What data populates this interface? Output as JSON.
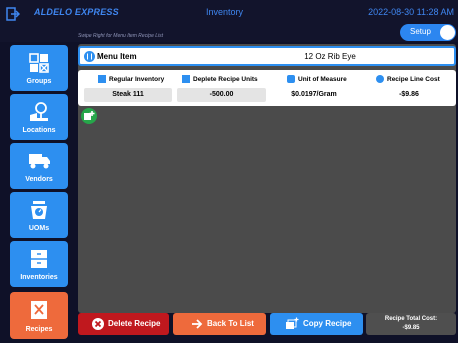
{
  "header": {
    "app_title": "ALDELO EXPRESS",
    "page_title": "Inventory",
    "datetime": "2022-08-30 11:28 AM",
    "setup_label": "Setup",
    "hint": "Swipe Right for Menu Item Recipe List"
  },
  "sidebar": {
    "items": [
      {
        "label": "Groups",
        "icon": "groups-grid-icon"
      },
      {
        "label": "Locations",
        "icon": "location-pin-icon"
      },
      {
        "label": "Vendors",
        "icon": "truck-icon"
      },
      {
        "label": "UOMs",
        "icon": "scale-icon"
      },
      {
        "label": "Inventories",
        "icon": "cabinet-icon"
      },
      {
        "label": "Recipes",
        "icon": "recipe-icon"
      }
    ],
    "active": "Recipes"
  },
  "menu_item": {
    "label": "Menu Item",
    "value": "12 Oz Rib Eye"
  },
  "recipe_table": {
    "columns": [
      "Regular Inventory",
      "Deplete Recipe Units",
      "Unit of Measure",
      "Recipe Line Cost"
    ],
    "row": {
      "regular_inventory": "Steak 111",
      "deplete_recipe_units": "-500.00",
      "unit_of_measure": "$0.0197/Gram",
      "recipe_line_cost": "-$9.86"
    }
  },
  "footer": {
    "delete_label": "Delete Recipe",
    "back_label": "Back To List",
    "copy_label": "Copy Recipe",
    "total_label": "Recipe Total Cost:",
    "total_value": "-$9.85"
  },
  "colors": {
    "accent_blue": "#2d8ff0",
    "active_orange": "#ee6a3c",
    "delete_red": "#c0181e",
    "add_green": "#26a64a"
  }
}
